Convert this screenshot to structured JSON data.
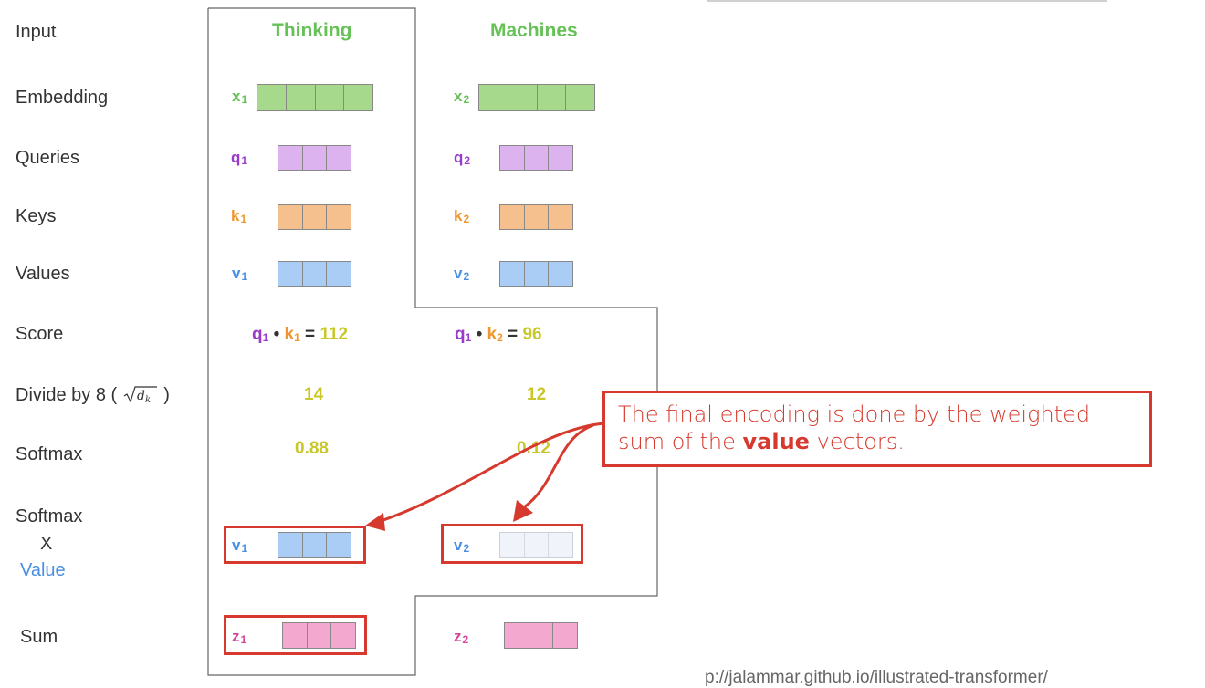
{
  "rows": {
    "input": "Input",
    "embedding": "Embedding",
    "queries": "Queries",
    "keys": "Keys",
    "values": "Values",
    "score": "Score",
    "divide": "Divide by 8 (",
    "divide_close": ")",
    "softmax": "Softmax",
    "softmax_x_value_1": "Softmax",
    "softmax_x_value_2": "X",
    "softmax_x_value_3": "Value",
    "sum": "Sum"
  },
  "words": {
    "thinking": "Thinking",
    "machines": "Machines"
  },
  "symbols": {
    "x1": "x",
    "x1_sub": "1",
    "x2": "x",
    "x2_sub": "2",
    "q1": "q",
    "q1_sub": "1",
    "q2": "q",
    "q2_sub": "2",
    "k1": "k",
    "k1_sub": "1",
    "k2": "k",
    "k2_sub": "2",
    "v1": "v",
    "v1_sub": "1",
    "v2": "v",
    "v2_sub": "2",
    "z1": "z",
    "z1_sub": "1",
    "z2": "z",
    "z2_sub": "2"
  },
  "scores": {
    "s1_q": "q",
    "s1_q_sub": "1",
    "s1_dot": " • ",
    "s1_k": "k",
    "s1_k_sub": "1",
    "s1_eq": " = ",
    "s1_val": "112",
    "s2_q": "q",
    "s2_q_sub": "1",
    "s2_dot": " • ",
    "s2_k": "k",
    "s2_k_sub": "2",
    "s2_eq": " = ",
    "s2_val": "96"
  },
  "divided": {
    "d1": "14",
    "d2": "12"
  },
  "softmax": {
    "s1": "0.88",
    "s2": "0.12"
  },
  "callout": {
    "line1": "The final encoding is done by the weighted",
    "line2_pre": "sum of the ",
    "line2_bold": "value",
    "line2_post": " vectors."
  },
  "footer": {
    "url": "p://jalammar.github.io/illustrated-transformer/"
  },
  "colors": {
    "green": "#66c157",
    "purple": "#9b3bc9",
    "orange": "#f0962e",
    "blue": "#4a90e2",
    "pink": "#d5479b",
    "olive": "#c9c72a",
    "red": "#d63a2e"
  }
}
